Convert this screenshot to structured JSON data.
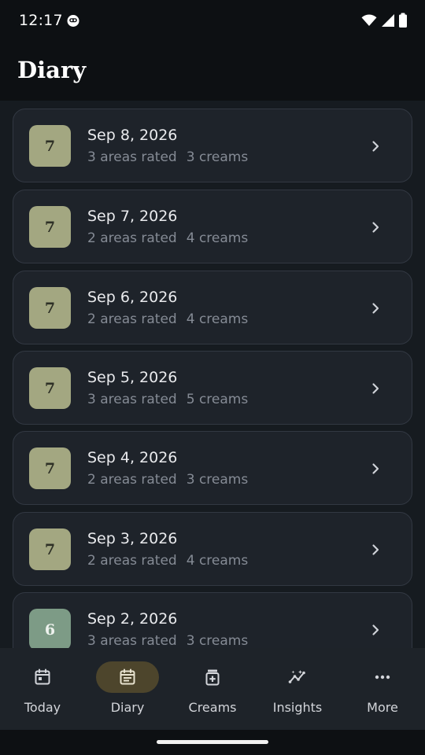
{
  "status_bar": {
    "time": "12:17",
    "icons": [
      "app-notification-icon",
      "wifi-icon",
      "signal-icon",
      "battery-icon"
    ]
  },
  "header": {
    "title": "Diary"
  },
  "entries": [
    {
      "score": "7",
      "date": "Sep 8, 2026",
      "areas": "3 areas rated",
      "creams": "3 creams",
      "badge_color": "#a3a781"
    },
    {
      "score": "7",
      "date": "Sep 7, 2026",
      "areas": "2 areas rated",
      "creams": "4 creams",
      "badge_color": "#a3a781"
    },
    {
      "score": "7",
      "date": "Sep 6, 2026",
      "areas": "2 areas rated",
      "creams": "4 creams",
      "badge_color": "#a3a781"
    },
    {
      "score": "7",
      "date": "Sep 5, 2026",
      "areas": "3 areas rated",
      "creams": "5 creams",
      "badge_color": "#a3a781"
    },
    {
      "score": "7",
      "date": "Sep 4, 2026",
      "areas": "2 areas rated",
      "creams": "3 creams",
      "badge_color": "#a3a781"
    },
    {
      "score": "7",
      "date": "Sep 3, 2026",
      "areas": "2 areas rated",
      "creams": "4 creams",
      "badge_color": "#a3a781"
    },
    {
      "score": "6",
      "date": "Sep 2, 2026",
      "areas": "3 areas rated",
      "creams": "3 creams",
      "badge_color": "#7d9b86"
    }
  ],
  "nav": {
    "active": "Diary",
    "items": [
      {
        "label": "Today",
        "icon": "calendar-today-icon"
      },
      {
        "label": "Diary",
        "icon": "calendar-diary-icon"
      },
      {
        "label": "Creams",
        "icon": "medication-icon"
      },
      {
        "label": "Insights",
        "icon": "insights-icon"
      },
      {
        "label": "More",
        "icon": "more-horiz-icon"
      }
    ]
  },
  "colors": {
    "background": "#161b20",
    "card": "#1e232a",
    "accent_pill": "#4d452c",
    "badge_score_7": "#a3a781",
    "badge_score_6": "#7d9b86"
  }
}
